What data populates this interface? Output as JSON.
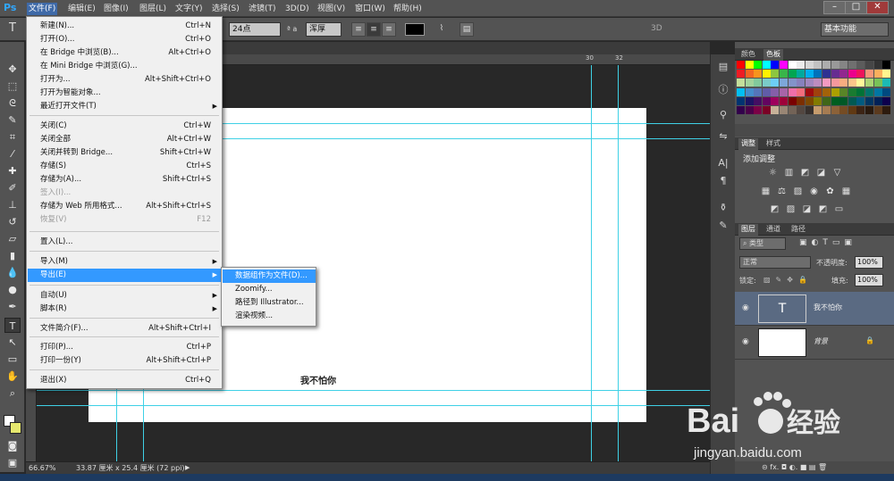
{
  "app": {
    "logo": "Ps"
  },
  "menubar": {
    "items": [
      "文件(F)",
      "编辑(E)",
      "图像(I)",
      "图层(L)",
      "文字(Y)",
      "选择(S)",
      "滤镜(T)",
      "3D(D)",
      "视图(V)",
      "窗口(W)",
      "帮助(H)"
    ]
  },
  "window_controls": {
    "minimize": "–",
    "maximize": "□",
    "close": "✕"
  },
  "options_bar": {
    "font_size": "24点",
    "antialias_icon": "ª a",
    "antialias": "浑厚",
    "label_3d": "3D",
    "workspace": "基本功能"
  },
  "file_menu": {
    "items": [
      {
        "label": "新建(N)...",
        "shortcut": "Ctrl+N"
      },
      {
        "label": "打开(O)...",
        "shortcut": "Ctrl+O"
      },
      {
        "label": "在 Bridge 中浏览(B)...",
        "shortcut": "Alt+Ctrl+O"
      },
      {
        "label": "在 Mini Bridge 中浏览(G)...",
        "shortcut": ""
      },
      {
        "label": "打开为...",
        "shortcut": "Alt+Shift+Ctrl+O"
      },
      {
        "label": "打开为智能对象...",
        "shortcut": ""
      },
      {
        "label": "最近打开文件(T)",
        "shortcut": "",
        "arrow": "▶"
      },
      {
        "label": "关闭(C)",
        "shortcut": "Ctrl+W"
      },
      {
        "label": "关闭全部",
        "shortcut": "Alt+Ctrl+W"
      },
      {
        "label": "关闭并转到 Bridge...",
        "shortcut": "Shift+Ctrl+W"
      },
      {
        "label": "存储(S)",
        "shortcut": "Ctrl+S"
      },
      {
        "label": "存储为(A)...",
        "shortcut": "Shift+Ctrl+S"
      },
      {
        "label": "签入(I)...",
        "shortcut": ""
      },
      {
        "label": "存储为 Web 所用格式...",
        "shortcut": "Alt+Shift+Ctrl+S"
      },
      {
        "label": "恢复(V)",
        "shortcut": "F12"
      },
      {
        "label": "置入(L)...",
        "shortcut": ""
      },
      {
        "label": "导入(M)",
        "shortcut": "",
        "arrow": "▶"
      },
      {
        "label": "导出(E)",
        "shortcut": "",
        "arrow": "▶"
      },
      {
        "label": "自动(U)",
        "shortcut": "",
        "arrow": "▶"
      },
      {
        "label": "脚本(R)",
        "shortcut": "",
        "arrow": "▶"
      },
      {
        "label": "文件简介(F)...",
        "shortcut": "Alt+Shift+Ctrl+I"
      },
      {
        "label": "打印(P)...",
        "shortcut": "Ctrl+P"
      },
      {
        "label": "打印一份(Y)",
        "shortcut": "Alt+Shift+Ctrl+P"
      },
      {
        "label": "退出(X)",
        "shortcut": "Ctrl+Q"
      }
    ]
  },
  "export_menu": {
    "items": [
      "数据组作为文件(D)...",
      "Zoomify...",
      "路径到 Illustrator...",
      "渲染视频..."
    ]
  },
  "ruler": {
    "ticks": [
      "30",
      "32"
    ]
  },
  "document": {
    "text": "我不怕你"
  },
  "status": {
    "zoom": "66.67%",
    "doc_info": "33.87 厘米 x 25.4 厘米 (72 ppi)"
  },
  "panels": {
    "swatch_tabs": [
      "颜色",
      "色板"
    ],
    "adjust_tabs": [
      "调整",
      "样式"
    ],
    "adjust_title": "添加调整",
    "layers_tabs": [
      "图层",
      "通道",
      "路径"
    ],
    "filter_kind": "类型",
    "blend_mode": "正常",
    "opacity_label": "不透明度:",
    "opacity_value": "100%",
    "lock_label": "锁定:",
    "fill_label": "填充:",
    "fill_value": "100%",
    "layers": [
      {
        "name": "我不怕你",
        "thumb": "T"
      },
      {
        "name": "背景",
        "thumb": ""
      }
    ],
    "footer_icons": "⊝  fx.  ◘  ◐.  ■  ▤  🗑"
  },
  "swatch_colors": [
    "#ff0000",
    "#ffff00",
    "#00ff00",
    "#00ffff",
    "#0000ff",
    "#ff00ff",
    "#ffffff",
    "#ebebeb",
    "#d6d6d6",
    "#c2c2c2",
    "#adadad",
    "#999999",
    "#858585",
    "#707070",
    "#5c5c5c",
    "#474747",
    "#333333",
    "#000000",
    "#ee1c24",
    "#f26522",
    "#f7941d",
    "#fff200",
    "#8dc63f",
    "#39b54a",
    "#00a651",
    "#00a99d",
    "#00aeef",
    "#0072bc",
    "#2e3192",
    "#662d91",
    "#92278f",
    "#ec008c",
    "#ed145b",
    "#f69679",
    "#fbaf5d",
    "#fff68f",
    "#c4df9b",
    "#a3d39c",
    "#82ca9c",
    "#7accc8",
    "#6dcff6",
    "#7da7d9",
    "#8393ca",
    "#8781bd",
    "#a186be",
    "#bd8cbf",
    "#f49ac2",
    "#f5989d",
    "#f9ad81",
    "#fdc68a",
    "#fff79a",
    "#abd373",
    "#79c257",
    "#1cbbb4",
    "#00bff3",
    "#448ccb",
    "#5574b9",
    "#605ca8",
    "#855fa8",
    "#a864a8",
    "#f06ea9",
    "#f26d7d",
    "#9e0b0f",
    "#a0410d",
    "#a36209",
    "#aba000",
    "#598527",
    "#197b30",
    "#007236",
    "#00746b",
    "#0076a3",
    "#004a80",
    "#003471",
    "#1b1464",
    "#440e62",
    "#630460",
    "#9e005d",
    "#9e0039",
    "#790000",
    "#7b2e00",
    "#7d4900",
    "#827b00",
    "#406618",
    "#005e20",
    "#005826",
    "#005952",
    "#005b7f",
    "#003663",
    "#002157",
    "#0d004c",
    "#32004b",
    "#4b0049",
    "#7b0046",
    "#7a0026",
    "#c7b299",
    "#998675",
    "#736357",
    "#534741",
    "#37302d",
    "#c69c6d",
    "#a67c52",
    "#8c6239",
    "#754c24",
    "#603913",
    "#3c2415",
    "#2a1a0e",
    "#5b3a1e",
    "#2d1b0e"
  ]
}
